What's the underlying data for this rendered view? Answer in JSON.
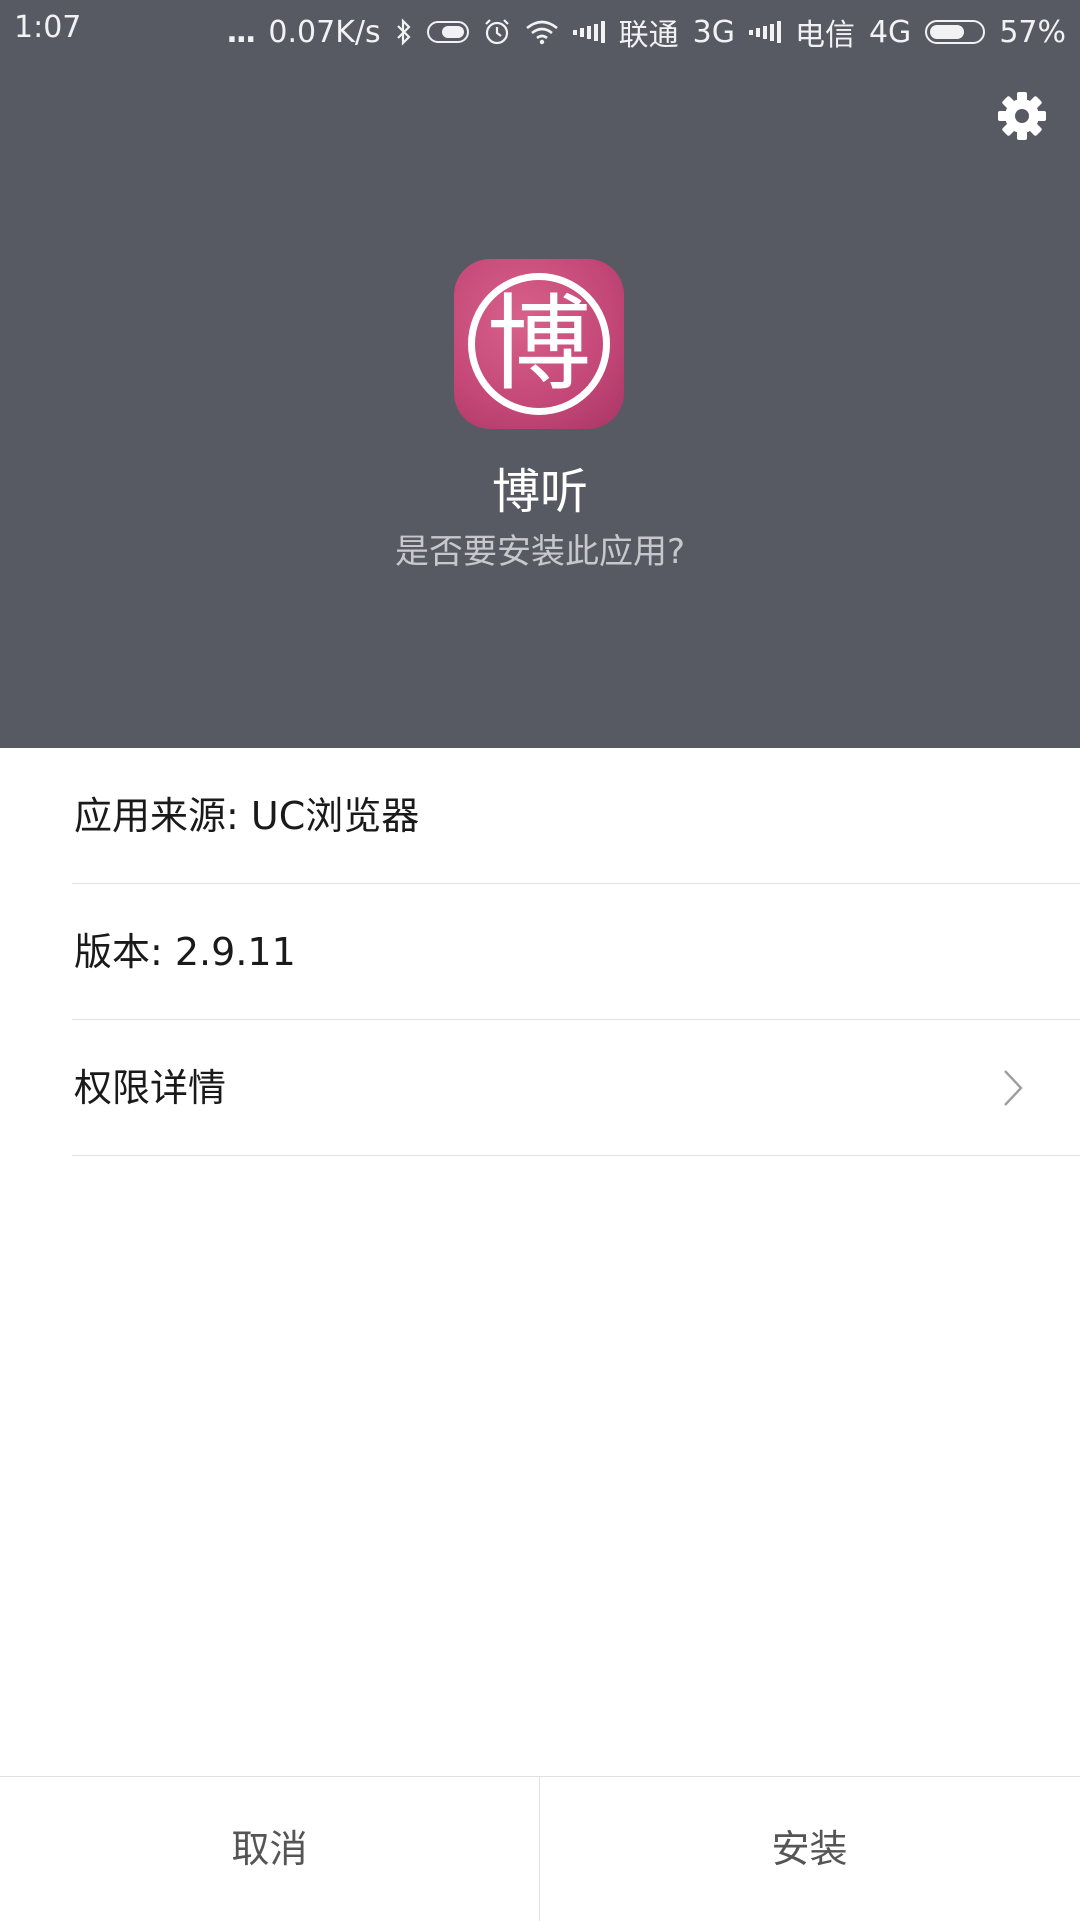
{
  "status_bar": {
    "time": "1:07",
    "more_indicator": "...",
    "net_speed": "0.07K/s",
    "carrier1": "联通",
    "network1": "3G",
    "carrier2": "电信",
    "network2": "4G",
    "battery": "57%",
    "icons": [
      "bluetooth-icon",
      "toggle-icon",
      "alarm-icon",
      "wifi-icon",
      "signal-icon",
      "signal-icon",
      "battery-icon"
    ]
  },
  "header": {
    "background": "#585a63",
    "settings_icon": "gear-icon",
    "app_icon_glyph": "博",
    "app_icon_color": "#c34777",
    "app_name": "博听",
    "question": "是否要安装此应用?"
  },
  "details": {
    "source": "应用来源: UC浏览器",
    "version": "版本: 2.9.11",
    "permissions": "权限详情",
    "permissions_icon": "chevron-right-icon"
  },
  "footer": {
    "cancel": "取消",
    "install": "安装"
  }
}
